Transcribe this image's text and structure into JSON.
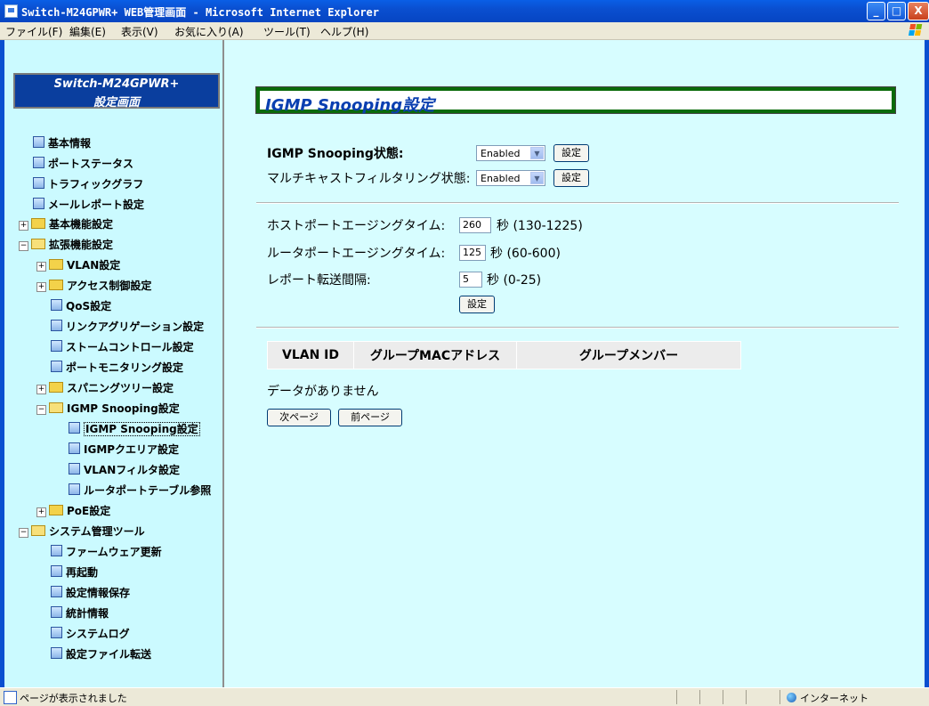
{
  "window": {
    "title": "Switch-M24GPWR+ WEB管理画面 - Microsoft Internet Explorer",
    "min_glyph": "_",
    "max_glyph": "□",
    "close_glyph": "X"
  },
  "menubar": {
    "file": "ファイル(F)",
    "edit": "編集(E)",
    "view": "表示(V)",
    "favorites": "お気に入り(A)",
    "tools": "ツール(T)",
    "help": "ヘルプ(H)"
  },
  "sidebar": {
    "logo_line1": "Switch-M24GPWR+",
    "logo_line2": "設定画面",
    "items": [
      {
        "label": "基本情報"
      },
      {
        "label": "ポートステータス"
      },
      {
        "label": "トラフィックグラフ"
      },
      {
        "label": "メールレポート設定"
      },
      {
        "label": "基本機能設定"
      },
      {
        "label": "拡張機能設定"
      },
      {
        "label": "VLAN設定"
      },
      {
        "label": "アクセス制御設定"
      },
      {
        "label": "QoS設定"
      },
      {
        "label": "リンクアグリゲーション設定"
      },
      {
        "label": "ストームコントロール設定"
      },
      {
        "label": "ポートモニタリング設定"
      },
      {
        "label": "スパニングツリー設定"
      },
      {
        "label": "IGMP Snooping設定"
      },
      {
        "label": "IGMP Snooping設定"
      },
      {
        "label": "IGMPクエリア設定"
      },
      {
        "label": "VLANフィルタ設定"
      },
      {
        "label": "ルータポートテーブル参照"
      },
      {
        "label": "PoE設定"
      },
      {
        "label": "システム管理ツール"
      },
      {
        "label": "ファームウェア更新"
      },
      {
        "label": "再起動"
      },
      {
        "label": "設定情報保存"
      },
      {
        "label": "統計情報"
      },
      {
        "label": "システムログ"
      },
      {
        "label": "設定ファイル転送"
      }
    ],
    "expand_plus": "+",
    "expand_minus": "−"
  },
  "main": {
    "page_title": "IGMP Snooping設定",
    "snooping_state_label": "IGMP Snooping状態:",
    "snooping_state_value": "Enabled",
    "multicast_filter_label": "マルチキャストフィルタリング状態:",
    "multicast_filter_value": "Enabled",
    "set_label": "設定",
    "host_aging_label": "ホストポートエージングタイム:",
    "host_aging_value": "260",
    "host_aging_unit": "秒 (130-1225)",
    "router_aging_label": "ルータポートエージングタイム:",
    "router_aging_value": "125",
    "router_aging_unit": "秒 (60-600)",
    "report_interval_label": "レポート転送間隔:",
    "report_interval_value": "5",
    "report_interval_unit": "秒 (0-25)",
    "table_headers": [
      "VLAN ID",
      "グループMACアドレス",
      "グループメンバー"
    ],
    "no_data": "データがありません",
    "next_page": "次ページ",
    "prev_page": "前ページ",
    "select_arrow": "▼"
  },
  "statusbar": {
    "status_text": "ページが表示されました",
    "zone_text": "インターネット"
  },
  "colors": {
    "titlebar": "#0a4fd0",
    "sidebar_bg": "#cbfaff",
    "content_bg": "#d7fdff",
    "header_border": "#0a6a0a",
    "header_text": "#0a3fb0"
  }
}
